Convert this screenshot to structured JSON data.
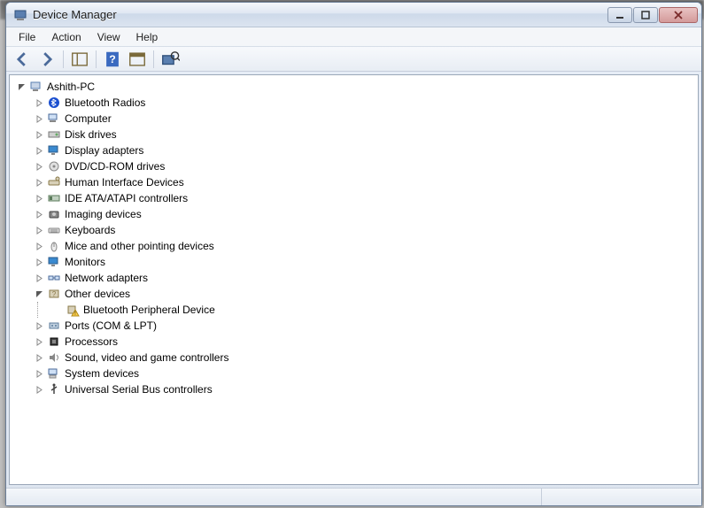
{
  "window": {
    "title": "Device Manager"
  },
  "menu": {
    "file": "File",
    "action": "Action",
    "view": "View",
    "help": "Help"
  },
  "tree": {
    "root": "Ashith-PC",
    "nodes": [
      {
        "label": "Bluetooth Radios",
        "icon": "bluetooth"
      },
      {
        "label": "Computer",
        "icon": "computer"
      },
      {
        "label": "Disk drives",
        "icon": "disk"
      },
      {
        "label": "Display adapters",
        "icon": "display"
      },
      {
        "label": "DVD/CD-ROM drives",
        "icon": "cdrom"
      },
      {
        "label": "Human Interface Devices",
        "icon": "hid"
      },
      {
        "label": "IDE ATA/ATAPI controllers",
        "icon": "ide"
      },
      {
        "label": "Imaging devices",
        "icon": "imaging"
      },
      {
        "label": "Keyboards",
        "icon": "keyboard"
      },
      {
        "label": "Mice and other pointing devices",
        "icon": "mouse"
      },
      {
        "label": "Monitors",
        "icon": "monitor"
      },
      {
        "label": "Network adapters",
        "icon": "network"
      },
      {
        "label": "Other devices",
        "icon": "other",
        "expanded": true,
        "children": [
          {
            "label": "Bluetooth Peripheral Device",
            "icon": "warning"
          }
        ]
      },
      {
        "label": "Ports (COM & LPT)",
        "icon": "ports"
      },
      {
        "label": "Processors",
        "icon": "processor"
      },
      {
        "label": "Sound, video and game controllers",
        "icon": "sound"
      },
      {
        "label": "System devices",
        "icon": "system"
      },
      {
        "label": "Universal Serial Bus controllers",
        "icon": "usb"
      }
    ]
  }
}
